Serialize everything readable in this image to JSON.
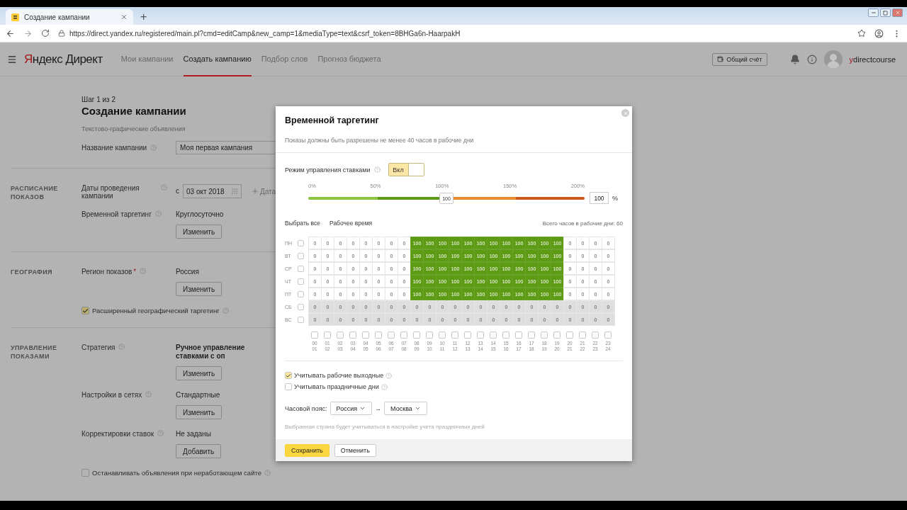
{
  "browser": {
    "tab_title": "Создание кампании",
    "new_tab": "+",
    "url": "https://direct.yandex.ru/registered/main.pl?cmd=editCamp&new_camp=1&mediaType=text&csrf_token=8BHGa6n-HaarpakH"
  },
  "header": {
    "logo": "Яндекс Директ",
    "nav": [
      {
        "label": "Мои кампании",
        "selected": false
      },
      {
        "label": "Создать кампанию",
        "selected": true
      },
      {
        "label": "Подбор слов",
        "selected": false
      },
      {
        "label": "Прогноз бюджета",
        "selected": false
      }
    ],
    "account_button": "Общий счёт",
    "username": "ydirectcourse"
  },
  "page": {
    "step": "Шаг 1 из 2",
    "title": "Создание кампании",
    "subtitle": "Текстово-графические объявления",
    "name_field": {
      "label": "Название кампании",
      "value": "Моя первая кампания"
    },
    "sections": [
      {
        "title": "РАСПИСАНИЕ ПОКАЗОВ",
        "rows": [
          {
            "kind": "date",
            "label": "Даты проведения кампании",
            "prefix": "с",
            "value": "03 окт 2018",
            "link": "Дата"
          },
          {
            "kind": "value",
            "label": "Временной таргетинг",
            "value": "Круглосуточно",
            "bold": false,
            "button": "Изменить"
          }
        ]
      },
      {
        "title": "ГЕОГРАФИЯ",
        "rows": [
          {
            "kind": "value",
            "label": "Регион показов",
            "required_mark": "*",
            "value": "Россия",
            "bold": false,
            "button": "Изменить"
          },
          {
            "kind": "checkbox",
            "label": "Расширенный географический таргетинг",
            "checked": true
          }
        ]
      },
      {
        "title": "УПРАВЛЕНИЕ ПОКАЗАМИ",
        "rows": [
          {
            "kind": "value",
            "label": "Стратегия",
            "value": "Ручное управление ставками с оп",
            "bold": true,
            "button": "Изменить"
          },
          {
            "kind": "value",
            "label": "Настройки в сетях",
            "value": "Стандартные",
            "bold": false,
            "button": "Изменить"
          },
          {
            "kind": "value",
            "label": "Корректировки ставок",
            "value": "Не заданы",
            "bold": false,
            "button": "Добавить"
          },
          {
            "kind": "checkbox",
            "label": "Останавливать объявления при неработающем сайте",
            "checked": false
          }
        ]
      }
    ]
  },
  "modal": {
    "title": "Временной таргетинг",
    "subtitle": "Показы должны быть разрешены не менее 40 часов в рабочие дни",
    "bid_mode": {
      "label": "Режим управления ставками",
      "toggle_label": "Вкл",
      "on": true
    },
    "slider": {
      "ticks": [
        "0%",
        "50%",
        "100%",
        "150%",
        "200%"
      ],
      "level": 0.5,
      "thumb_label": "100",
      "value": "100",
      "unit": "%"
    },
    "select_all": "Выбрать все",
    "work_time": "Рабочее время",
    "total_hours": "Всего часов в рабочие дни: 60",
    "days": [
      {
        "label": "ПН",
        "checked": false,
        "weekend": false,
        "cells": [
          "0",
          "0",
          "0",
          "0",
          "0",
          "0",
          "0",
          "0",
          "100",
          "100",
          "100",
          "100",
          "100",
          "100",
          "100",
          "100",
          "100",
          "100",
          "100",
          "100",
          "0",
          "0",
          "0",
          "0"
        ]
      },
      {
        "label": "ВТ",
        "checked": false,
        "weekend": false,
        "cells": [
          "0",
          "0",
          "0",
          "0",
          "0",
          "0",
          "0",
          "0",
          "100",
          "100",
          "100",
          "100",
          "100",
          "100",
          "100",
          "100",
          "100",
          "100",
          "100",
          "100",
          "0",
          "0",
          "0",
          "0"
        ]
      },
      {
        "label": "СР",
        "checked": false,
        "weekend": false,
        "cells": [
          "0",
          "0",
          "0",
          "0",
          "0",
          "0",
          "0",
          "0",
          "100",
          "100",
          "100",
          "100",
          "100",
          "100",
          "100",
          "100",
          "100",
          "100",
          "100",
          "100",
          "0",
          "0",
          "0",
          "0"
        ]
      },
      {
        "label": "ЧТ",
        "checked": false,
        "weekend": false,
        "cells": [
          "0",
          "0",
          "0",
          "0",
          "0",
          "0",
          "0",
          "0",
          "100",
          "100",
          "100",
          "100",
          "100",
          "100",
          "100",
          "100",
          "100",
          "100",
          "100",
          "100",
          "0",
          "0",
          "0",
          "0"
        ]
      },
      {
        "label": "ПТ",
        "checked": false,
        "weekend": false,
        "cells": [
          "0",
          "0",
          "0",
          "0",
          "0",
          "0",
          "0",
          "0",
          "100",
          "100",
          "100",
          "100",
          "100",
          "100",
          "100",
          "100",
          "100",
          "100",
          "100",
          "100",
          "0",
          "0",
          "0",
          "0"
        ]
      },
      {
        "label": "СБ",
        "checked": false,
        "weekend": true,
        "cells": [
          "0",
          "0",
          "0",
          "0",
          "0",
          "0",
          "0",
          "0",
          "0",
          "0",
          "0",
          "0",
          "0",
          "0",
          "0",
          "0",
          "0",
          "0",
          "0",
          "0",
          "0",
          "0",
          "0",
          "0"
        ]
      },
      {
        "label": "ВС",
        "checked": false,
        "weekend": true,
        "cells": [
          "0",
          "0",
          "0",
          "0",
          "0",
          "0",
          "0",
          "0",
          "0",
          "0",
          "0",
          "0",
          "0",
          "0",
          "0",
          "0",
          "0",
          "0",
          "0",
          "0",
          "0",
          "0",
          "0",
          "0"
        ]
      }
    ],
    "hours": [
      {
        "from": "00",
        "to": "01",
        "checked": false
      },
      {
        "from": "01",
        "to": "02",
        "checked": false
      },
      {
        "from": "02",
        "to": "03",
        "checked": false
      },
      {
        "from": "03",
        "to": "04",
        "checked": false
      },
      {
        "from": "04",
        "to": "05",
        "checked": false
      },
      {
        "from": "05",
        "to": "06",
        "checked": false
      },
      {
        "from": "06",
        "to": "07",
        "checked": false
      },
      {
        "from": "07",
        "to": "08",
        "checked": false
      },
      {
        "from": "08",
        "to": "09",
        "checked": false
      },
      {
        "from": "09",
        "to": "10",
        "checked": false
      },
      {
        "from": "10",
        "to": "11",
        "checked": false
      },
      {
        "from": "11",
        "to": "12",
        "checked": false
      },
      {
        "from": "12",
        "to": "13",
        "checked": false
      },
      {
        "from": "13",
        "to": "14",
        "checked": false
      },
      {
        "from": "14",
        "to": "15",
        "checked": false
      },
      {
        "from": "15",
        "to": "16",
        "checked": false
      },
      {
        "from": "16",
        "to": "17",
        "checked": false
      },
      {
        "from": "17",
        "to": "18",
        "checked": false
      },
      {
        "from": "18",
        "to": "19",
        "checked": false
      },
      {
        "from": "19",
        "to": "20",
        "checked": false
      },
      {
        "from": "20",
        "to": "21",
        "checked": false
      },
      {
        "from": "21",
        "to": "22",
        "checked": false
      },
      {
        "from": "22",
        "to": "23",
        "checked": false
      },
      {
        "from": "23",
        "to": "24",
        "checked": false
      }
    ],
    "options": [
      {
        "label": "Учитывать рабочие выходные",
        "checked": true
      },
      {
        "label": "Учитывать праздничные дни",
        "checked": false
      }
    ],
    "timezone": {
      "label": "Часовой пояс:",
      "country": "Россия",
      "arrow": "→",
      "city": "Москва"
    },
    "note": "Выбранная страна будет учитываться в настройке учета праздничных дней",
    "buttons": [
      {
        "label": "Сохранить",
        "kind": "primary"
      },
      {
        "label": "Отменить",
        "kind": "secondary"
      }
    ]
  }
}
